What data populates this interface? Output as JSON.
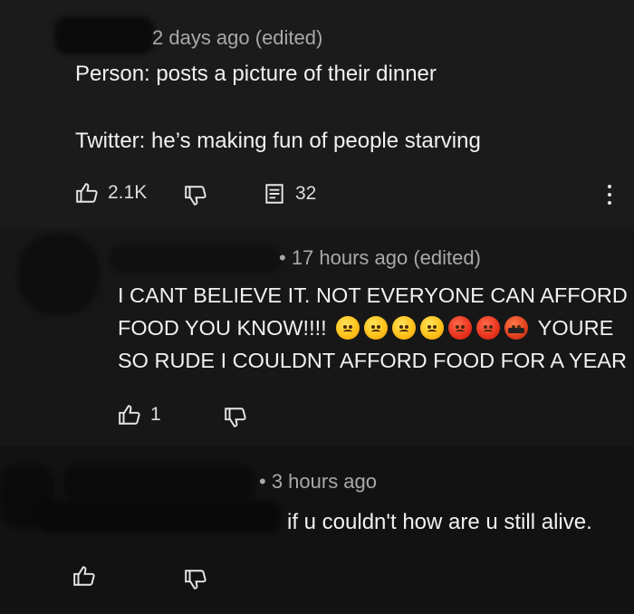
{
  "comments": [
    {
      "meta": "2 days ago (edited)",
      "lines": [
        "Person: posts a picture of their dinner",
        "",
        "Twitter: he’s making fun of people starving"
      ],
      "likes": "2.1K",
      "replies": "32"
    },
    {
      "meta": "• 17 hours ago (edited)",
      "line1": "I CANT BELIEVE IT. NOT EVERYONE CAN AFFORD",
      "line2_start": "FOOD YOU KNOW!!!!",
      "line2_end": "YOURE",
      "line3": "SO RUDE I COULDNT AFFORD FOOD FOR A YEAR",
      "emojis": [
        "angry-yellow",
        "angry-yellow",
        "angry-yellow",
        "angry-yellow",
        "angry-red",
        "angry-red",
        "cursing-face"
      ],
      "likes": "1"
    },
    {
      "meta": "• 3 hours ago",
      "text": "if u couldn't how are u still alive."
    }
  ],
  "icons": {
    "like": "thumbs-up-icon",
    "dislike": "thumbs-down-icon",
    "reply": "comment-icon",
    "menu": "more-vertical-icon"
  }
}
